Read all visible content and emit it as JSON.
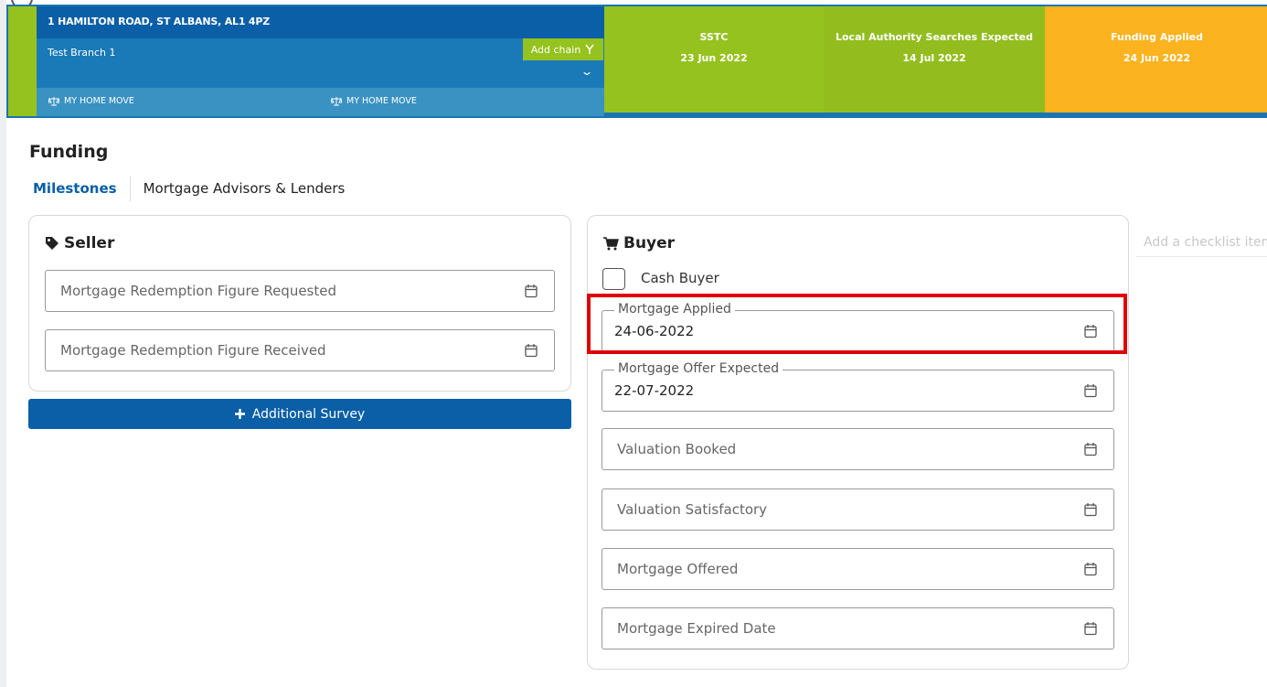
{
  "header": {
    "address": "1 HAMILTON ROAD, ST ALBANS, AL1 4PZ",
    "branch": "Test Branch 1",
    "add_chain_label": "Add chain",
    "move_label_1": "MY HOME MOVE",
    "move_label_2": "MY HOME MOVE",
    "milestones": [
      {
        "title": "SSTC",
        "date": "23 Jun 2022",
        "color": "#96c21f"
      },
      {
        "title": "Local Authority Searches Expected",
        "date": "14 Jul 2022",
        "color": "#96c21f"
      },
      {
        "title": "Funding Applied",
        "date": "24 Jun 2022",
        "color": "#fbb320"
      }
    ]
  },
  "section": {
    "title": "Funding",
    "tabs": [
      "Milestones",
      "Mortgage Advisors & Lenders"
    ],
    "active_tab": "Milestones"
  },
  "seller": {
    "title": "Seller",
    "fields": [
      {
        "placeholder": "Mortgage Redemption Figure Requested",
        "value": ""
      },
      {
        "placeholder": "Mortgage Redemption Figure Received",
        "value": ""
      }
    ],
    "additional_survey_label": "Additional Survey"
  },
  "buyer": {
    "title": "Buyer",
    "cash_buyer_label": "Cash Buyer",
    "cash_buyer_checked": false,
    "fields": [
      {
        "label": "Mortgage Applied",
        "value": "24-06-2022"
      },
      {
        "label": "Mortgage Offer Expected",
        "value": "22-07-2022"
      },
      {
        "placeholder": "Valuation Booked",
        "value": ""
      },
      {
        "placeholder": "Valuation Satisfactory",
        "value": ""
      },
      {
        "placeholder": "Mortgage Offered",
        "value": ""
      },
      {
        "placeholder": "Mortgage Expired Date",
        "value": ""
      }
    ]
  },
  "checklist": {
    "placeholder": "Add a checklist item"
  },
  "colors": {
    "primary": "#0a5fa6",
    "green": "#96c21f",
    "orange": "#fbb320",
    "highlight": "#e00000"
  }
}
